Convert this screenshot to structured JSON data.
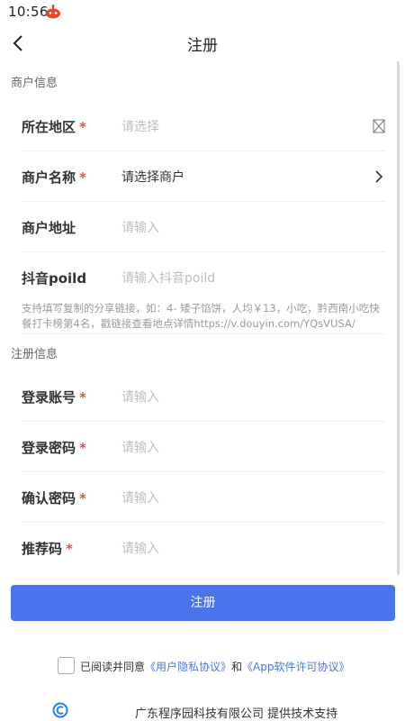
{
  "status_bar": {
    "time": "10:56"
  },
  "nav": {
    "title": "注册"
  },
  "sections": {
    "merchant": "商户信息",
    "register": "注册信息"
  },
  "merchant_fields": [
    {
      "label": "所在地区",
      "required": "*",
      "value": "请选择"
    },
    {
      "label": "商户名称",
      "required": "*",
      "value": "请选择商户"
    },
    {
      "label": "商户地址",
      "required": "",
      "value": "请输入"
    },
    {
      "label": "抖音poild",
      "required": "",
      "value": "请输入抖音poild"
    }
  ],
  "hint": "支持填写复制的分享链接，如：4- 矮子馅饼，人均￥13，小吃，黔西南小吃快餐打卡榜第4名，戳链接查看地点详情https://v.douyin.com/YQsVUSA/",
  "register_fields": [
    {
      "label": "登录账号",
      "required": "*",
      "value": "请输入"
    },
    {
      "label": "登录密码",
      "required": "*",
      "value": "请输入"
    },
    {
      "label": "确认密码",
      "required": "*",
      "value": "请输入"
    },
    {
      "label": "推荐码",
      "required": "*",
      "value": "请输入"
    }
  ],
  "submit_label": "注册",
  "agreement": {
    "prefix": "已阅读并同意",
    "privacy_link": "《用户隐私协议》",
    "conjunction": "和",
    "license_link": "《App软件许可协议》"
  },
  "footer": {
    "text": "广东程序园科技有限公司 提供技术支持"
  },
  "colors": {
    "primary": "#4a74ec",
    "required": "#e94b4b",
    "placeholder": "#bdbdbd"
  }
}
